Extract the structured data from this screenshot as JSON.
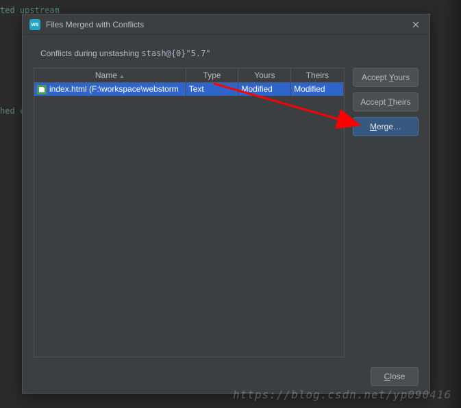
{
  "background": {
    "line1": "ted upstream",
    "line2": "hed c"
  },
  "dialog": {
    "title": "Files Merged with Conflicts",
    "subtitle_prefix": "Conflicts during unstashing ",
    "subtitle_stash": "stash@{0}\"5.7\"",
    "columns": {
      "name": "Name",
      "type": "Type",
      "yours": "Yours",
      "theirs": "Theirs"
    },
    "rows": [
      {
        "name": "index.html (F:\\workspace\\webstorm",
        "type": "Text",
        "yours": "Modified",
        "theirs": "Modified"
      }
    ],
    "buttons": {
      "accept_yours_pre": "Accept ",
      "accept_yours_key": "Y",
      "accept_yours_post": "ours",
      "accept_theirs_pre": "Accept ",
      "accept_theirs_key": "T",
      "accept_theirs_post": "heirs",
      "merge_key": "M",
      "merge_post": "erge…",
      "close_key": "C",
      "close_post": "lose"
    }
  },
  "watermark": "https://blog.csdn.net/yp090416"
}
